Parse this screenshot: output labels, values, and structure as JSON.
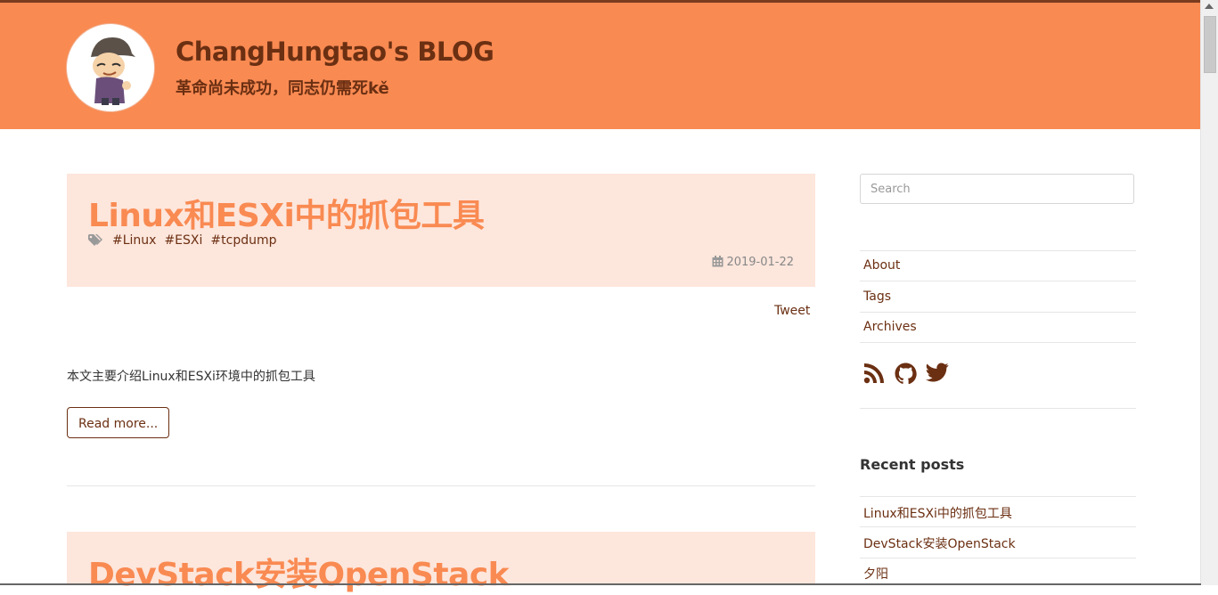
{
  "header": {
    "title": "ChangHungtao's BLOG",
    "subtitle": "革命尚未成功，同志仍需死kě"
  },
  "posts": [
    {
      "title": "Linux和ESXi中的抓包工具",
      "tags": [
        "#Linux",
        "#ESXi",
        "#tcpdump"
      ],
      "date": "2019-01-22",
      "tweet": "Tweet",
      "excerpt": "本文主要介绍Linux和ESXi环境中的抓包工具",
      "read_more": "Read more..."
    },
    {
      "title": "DevStack安装OpenStack"
    }
  ],
  "sidebar": {
    "search_placeholder": "Search",
    "nav": [
      "About",
      "Tags",
      "Archives"
    ],
    "social_icons": [
      "rss-icon",
      "github-icon",
      "twitter-icon"
    ],
    "recent_heading": "Recent posts",
    "recent": [
      "Linux和ESXi中的抓包工具",
      "DevStack安装OpenStack",
      "夕阳"
    ]
  },
  "colors": {
    "header_bg": "#f98a52",
    "post_header_bg": "#fde6dc",
    "accent_text": "#6b2f12",
    "post_title": "#f98a52"
  }
}
